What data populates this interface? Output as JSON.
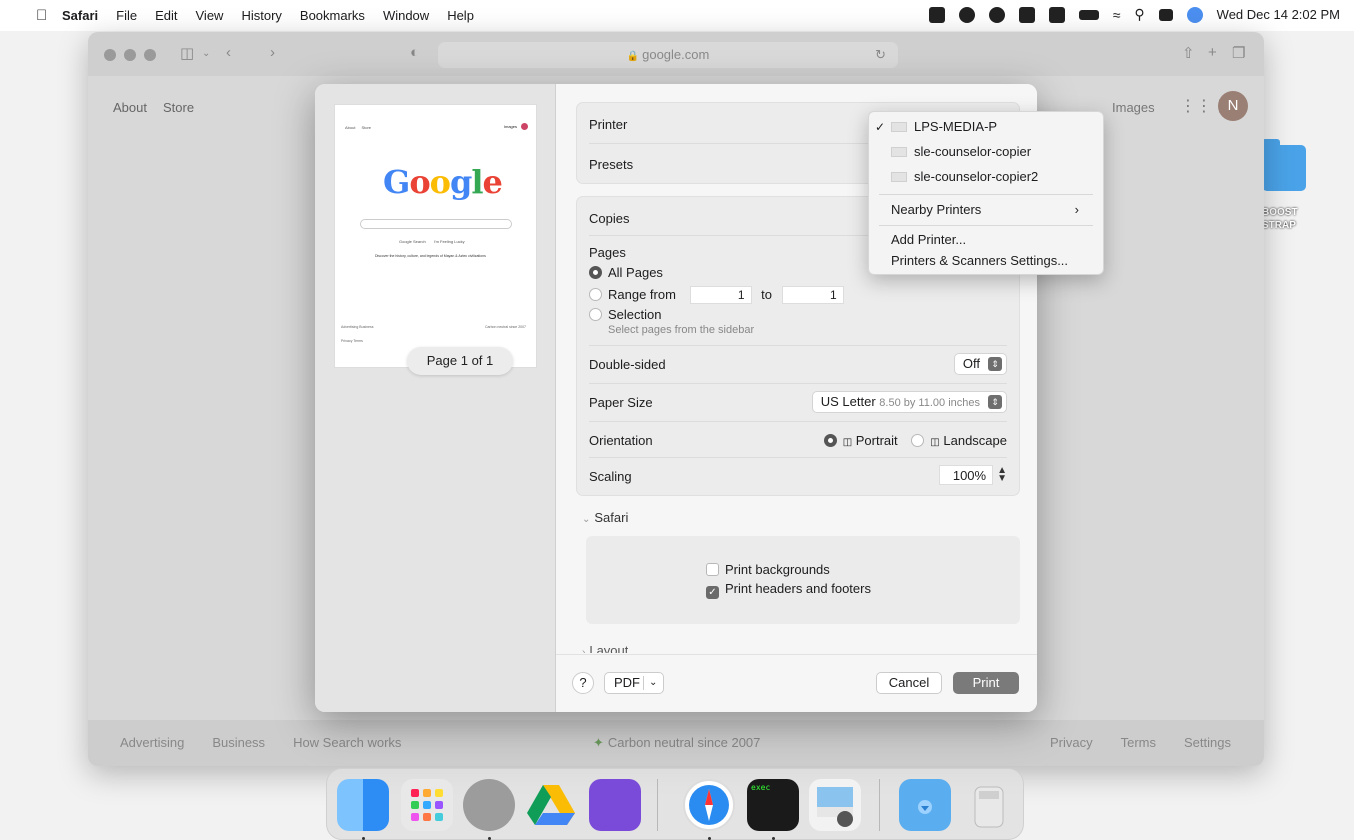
{
  "menubar": {
    "apple": "",
    "items": [
      "Safari",
      "File",
      "Edit",
      "View",
      "History",
      "Bookmarks",
      "Window",
      "Help"
    ],
    "clock": "Wed Dec 14  2:02 PM"
  },
  "desktop": {
    "folder_label": "BOOST\nSTRAP"
  },
  "browser": {
    "url": "google.com",
    "top_links": [
      "About",
      "Store"
    ],
    "images_link": "Images",
    "avatar_letter": "N",
    "footer_left": [
      "Advertising",
      "Business",
      "How Search works"
    ],
    "footer_mid": "Carbon neutral since 2007",
    "footer_right": [
      "Privacy",
      "Terms",
      "Settings"
    ]
  },
  "preview": {
    "page_label": "Page 1 of 1",
    "nav": [
      "About",
      "Store"
    ],
    "buttons": [
      "Google Search",
      "I'm Feeling Lucky"
    ],
    "line": "Discover the history, culture, and legends of Mayan & Aztec civilizations",
    "foot_left": "Advertising   Business",
    "foot_left2": "Privacy   Terms",
    "foot_right": "Carbon neutral since 2007"
  },
  "print": {
    "printer_label": "Printer",
    "presets_label": "Presets",
    "copies_label": "Copies",
    "pages_label": "Pages",
    "all_pages": "All Pages",
    "range_from": "Range from",
    "range_start": "1",
    "range_to": "to",
    "range_end": "1",
    "selection": "Selection",
    "selection_hint": "Select pages from the sidebar",
    "double_sided_label": "Double-sided",
    "double_sided_value": "Off",
    "paper_size_label": "Paper Size",
    "paper_size_value": "US Letter",
    "paper_size_detail": "8.50 by 11.00 inches",
    "orientation_label": "Orientation",
    "portrait": "Portrait",
    "landscape": "Landscape",
    "scaling_label": "Scaling",
    "scaling_value": "100%",
    "safari_section": "Safari",
    "print_backgrounds": "Print backgrounds",
    "print_headers": "Print headers and footers",
    "layout_section": "Layout",
    "help": "?",
    "pdf": "PDF",
    "cancel": "Cancel",
    "print": "Print"
  },
  "printer_menu": {
    "printers": [
      "LPS-MEDIA-P",
      "sle-counselor-copier",
      "sle-counselor-copier2"
    ],
    "selected_index": 0,
    "nearby": "Nearby Printers",
    "add": "Add Printer...",
    "settings": "Printers & Scanners Settings..."
  },
  "dock": {
    "terminal_text": "exec"
  }
}
